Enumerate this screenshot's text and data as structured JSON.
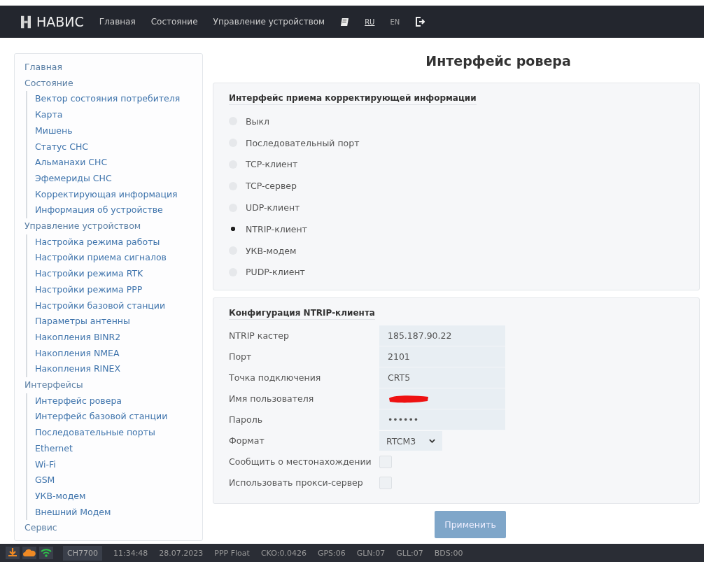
{
  "navbar": {
    "brand": "НАВИС",
    "links": [
      {
        "label": "Главная",
        "kind": "text"
      },
      {
        "label": "Состояние",
        "kind": "text"
      },
      {
        "label": "Управление устройством",
        "kind": "text"
      },
      {
        "kind": "book"
      },
      {
        "label": "RU",
        "kind": "lang",
        "selected": true
      },
      {
        "label": "EN",
        "kind": "lang",
        "selected": false
      },
      {
        "kind": "logout"
      }
    ]
  },
  "sidebar": {
    "items": [
      {
        "label": "Главная"
      },
      {
        "label": "Состояние",
        "children": [
          {
            "label": "Вектор состояния потребителя"
          },
          {
            "label": "Карта"
          },
          {
            "label": "Мишень"
          },
          {
            "label": "Статус СНС"
          },
          {
            "label": "Альманахи СНС"
          },
          {
            "label": "Эфемериды СНС"
          },
          {
            "label": "Корректирующая информация"
          },
          {
            "label": "Информация об устройстве"
          }
        ]
      },
      {
        "label": "Управление устройством",
        "children": [
          {
            "label": "Настройка режима работы"
          },
          {
            "label": "Настройки приема сигналов"
          },
          {
            "label": "Настройки режима RTK"
          },
          {
            "label": "Настройки режима PPP"
          },
          {
            "label": "Настройки базовой станции"
          },
          {
            "label": "Параметры антенны"
          },
          {
            "label": "Накопления BINR2"
          },
          {
            "label": "Накопления NMEA"
          },
          {
            "label": "Накопления RINEX"
          }
        ]
      },
      {
        "label": "Интерфейсы",
        "children": [
          {
            "label": "Интерфейс ровера"
          },
          {
            "label": "Интерфейс базовой станции"
          },
          {
            "label": "Последовательные порты"
          },
          {
            "label": "Ethernet"
          },
          {
            "label": "Wi-Fi"
          },
          {
            "label": "GSM"
          },
          {
            "label": "УКВ-модем"
          },
          {
            "label": "Внешний Модем"
          }
        ]
      },
      {
        "label": "Сервис"
      }
    ]
  },
  "page_title": "Интерфейс ровера",
  "interface_section": {
    "title": "Интерфейс приема корректирующей информации",
    "options": [
      {
        "label": "Выкл",
        "selected": false
      },
      {
        "label": "Последовательный порт",
        "selected": false
      },
      {
        "label": "TCP-клиент",
        "selected": false
      },
      {
        "label": "TCP-сервер",
        "selected": false
      },
      {
        "label": "UDP-клиент",
        "selected": false
      },
      {
        "label": "NTRIP-клиент",
        "selected": true
      },
      {
        "label": "УКВ-модем",
        "selected": false
      },
      {
        "label": "PUDP-клиент",
        "selected": false
      }
    ]
  },
  "ntrip_section": {
    "title": "Конфигурация NTRIP-клиента",
    "fields": [
      {
        "label": "NTRIP кастер",
        "kind": "text",
        "value": "185.187.90.22"
      },
      {
        "label": "Порт",
        "kind": "text",
        "value": "2101"
      },
      {
        "label": "Точка подключения",
        "kind": "text",
        "value": "CRT5"
      },
      {
        "label": "Имя пользователя",
        "kind": "redacted"
      },
      {
        "label": "Пароль",
        "kind": "password",
        "value": "••••••"
      },
      {
        "label": "Формат",
        "kind": "select",
        "value": "RTCM3"
      },
      {
        "label": "Сообщить о местонахождении",
        "kind": "checkbox",
        "checked": false
      },
      {
        "label": "Использовать прокси-сервер",
        "kind": "checkbox",
        "checked": false
      }
    ]
  },
  "apply_button": "Применить",
  "status_bar": {
    "icons": [
      {
        "kind": "download"
      },
      {
        "kind": "cloud"
      },
      {
        "kind": "wifi"
      }
    ],
    "device": "CH7700",
    "items": [
      "11:34:48",
      "28.07.2023",
      "PPP Float",
      "CKO:0.0426",
      "GPS:06",
      "GLN:07",
      "GLL:07",
      "BDS:00"
    ]
  }
}
